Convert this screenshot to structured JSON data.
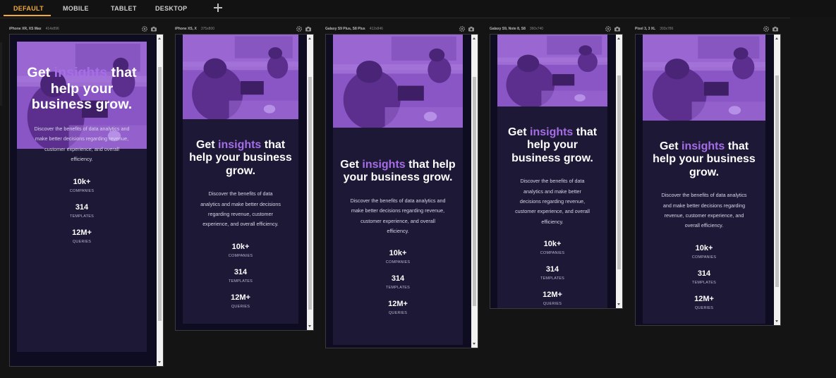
{
  "tabs": [
    {
      "label": "DEFAULT",
      "active": true
    },
    {
      "label": "MOBILE",
      "active": false
    },
    {
      "label": "TABLET",
      "active": false
    },
    {
      "label": "DESKTOP",
      "active": false
    }
  ],
  "colors": {
    "accent": "#f0a93b",
    "highlight": "#a66ee6",
    "card": "#1c1836",
    "photo_tint": "#8a55c4"
  },
  "content": {
    "headline_pre": "Get ",
    "headline_hl": "insights",
    "headline_post": " that help your business grow.",
    "description": "Discover the benefits of data analytics and make better decisions regarding revenue, customer experience, and overall efficiency.",
    "stats": [
      {
        "value": "10k+",
        "label": "COMPANIES"
      },
      {
        "value": "314",
        "label": "TEMPLATES"
      },
      {
        "value": "12M+",
        "label": "QUERIES"
      }
    ]
  },
  "devices": [
    {
      "name": "iPhone XR, XS Max",
      "size": "414x896"
    },
    {
      "name": "iPhone XS, X",
      "size": "375x800"
    },
    {
      "name": "Galaxy S9 Plus, S8 Plus",
      "size": "412x846"
    },
    {
      "name": "Galaxy S9, Note 8, S8",
      "size": "360x740"
    },
    {
      "name": "Pixel 3, 3 XL",
      "size": "393x786"
    }
  ],
  "icons": {
    "settings": "gear-icon",
    "screenshot": "camera-icon",
    "add": "plus-icon"
  }
}
